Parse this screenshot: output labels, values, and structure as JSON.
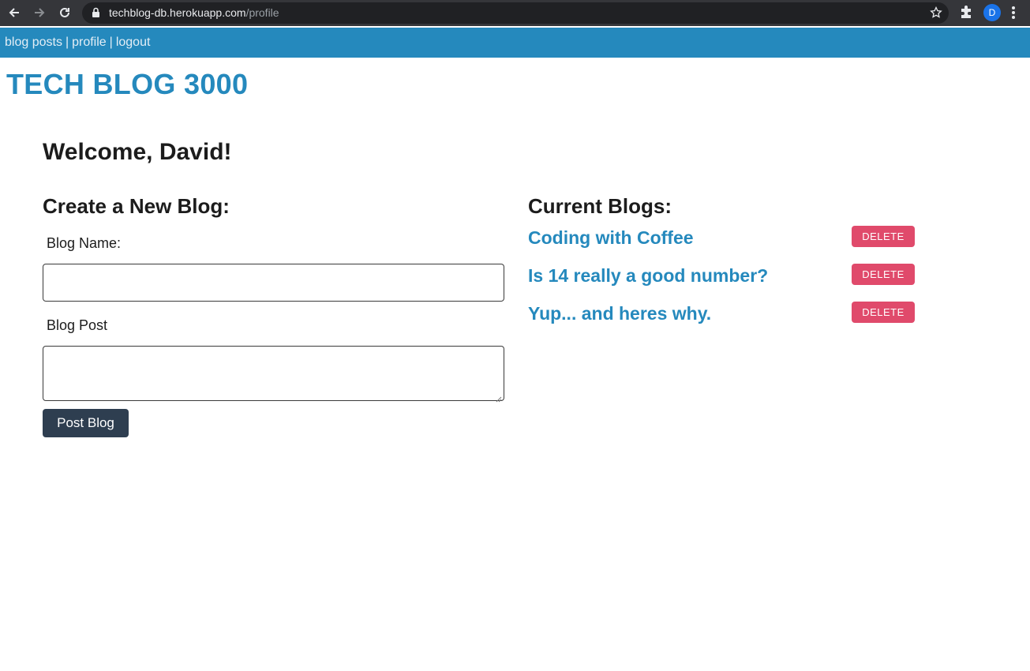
{
  "browser": {
    "url_host": "techblog-db.herokuapp.com",
    "url_path": "/profile",
    "profile_initial": "D",
    "icons": [
      "back-arrow-icon",
      "forward-arrow-icon",
      "reload-icon",
      "lock-icon",
      "star-icon",
      "puzzle-icon",
      "kebab-menu-icon"
    ]
  },
  "nav": {
    "items": [
      {
        "label": "blog posts"
      },
      {
        "label": "profile"
      },
      {
        "label": "logout"
      }
    ],
    "separator": "|"
  },
  "site_title": "TECH BLOG 3000",
  "welcome": "Welcome, David!",
  "create": {
    "heading": "Create a New Blog:",
    "name_label": "Blog Name:",
    "name_value": "",
    "post_label": "Blog Post",
    "post_value": "",
    "submit_label": "Post Blog"
  },
  "current": {
    "heading": "Current Blogs:",
    "blogs": [
      {
        "title": "Coding with Coffee",
        "delete_label": "DELETE"
      },
      {
        "title": "Is 14 really a good number?",
        "delete_label": "DELETE"
      },
      {
        "title": "Yup... and heres why.",
        "delete_label": "DELETE"
      }
    ]
  },
  "colors": {
    "brand_blue": "#2589bd",
    "button_dark": "#2e3e50",
    "delete_red": "#e04a6b"
  }
}
